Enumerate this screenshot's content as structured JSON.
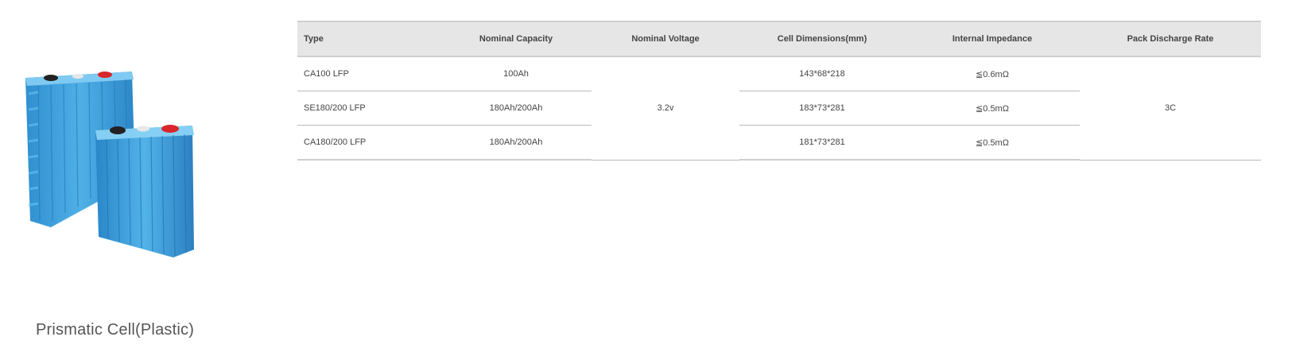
{
  "product": {
    "caption": "Prismatic  Cell(Plastic)",
    "image_alt": "blue-prismatic-battery-cells",
    "colors": {
      "cell_blue": "#3fa3dc",
      "terminal_red": "#d8262b",
      "terminal_black": "#222222"
    }
  },
  "spec_table": {
    "headers": {
      "type": "Type",
      "capacity": "Nominal Capacity",
      "voltage": "Nominal Voltage",
      "dimensions": "Cell Dimensions(mm)",
      "impedance": "Internal Impedance",
      "discharge": "Pack Discharge Rate"
    },
    "shared": {
      "voltage": "3.2v",
      "discharge": "3C"
    },
    "rows": [
      {
        "type": "CA100 LFP",
        "capacity": "100Ah",
        "dimensions": "143*68*218",
        "impedance": "≦0.6mΩ"
      },
      {
        "type": "SE180/200 LFP",
        "capacity": "180Ah/200Ah",
        "dimensions": "183*73*281",
        "impedance": "≦0.5mΩ"
      },
      {
        "type": "CA180/200 LFP",
        "capacity": "180Ah/200Ah",
        "dimensions": "181*73*281",
        "impedance": "≦0.5mΩ"
      }
    ]
  }
}
